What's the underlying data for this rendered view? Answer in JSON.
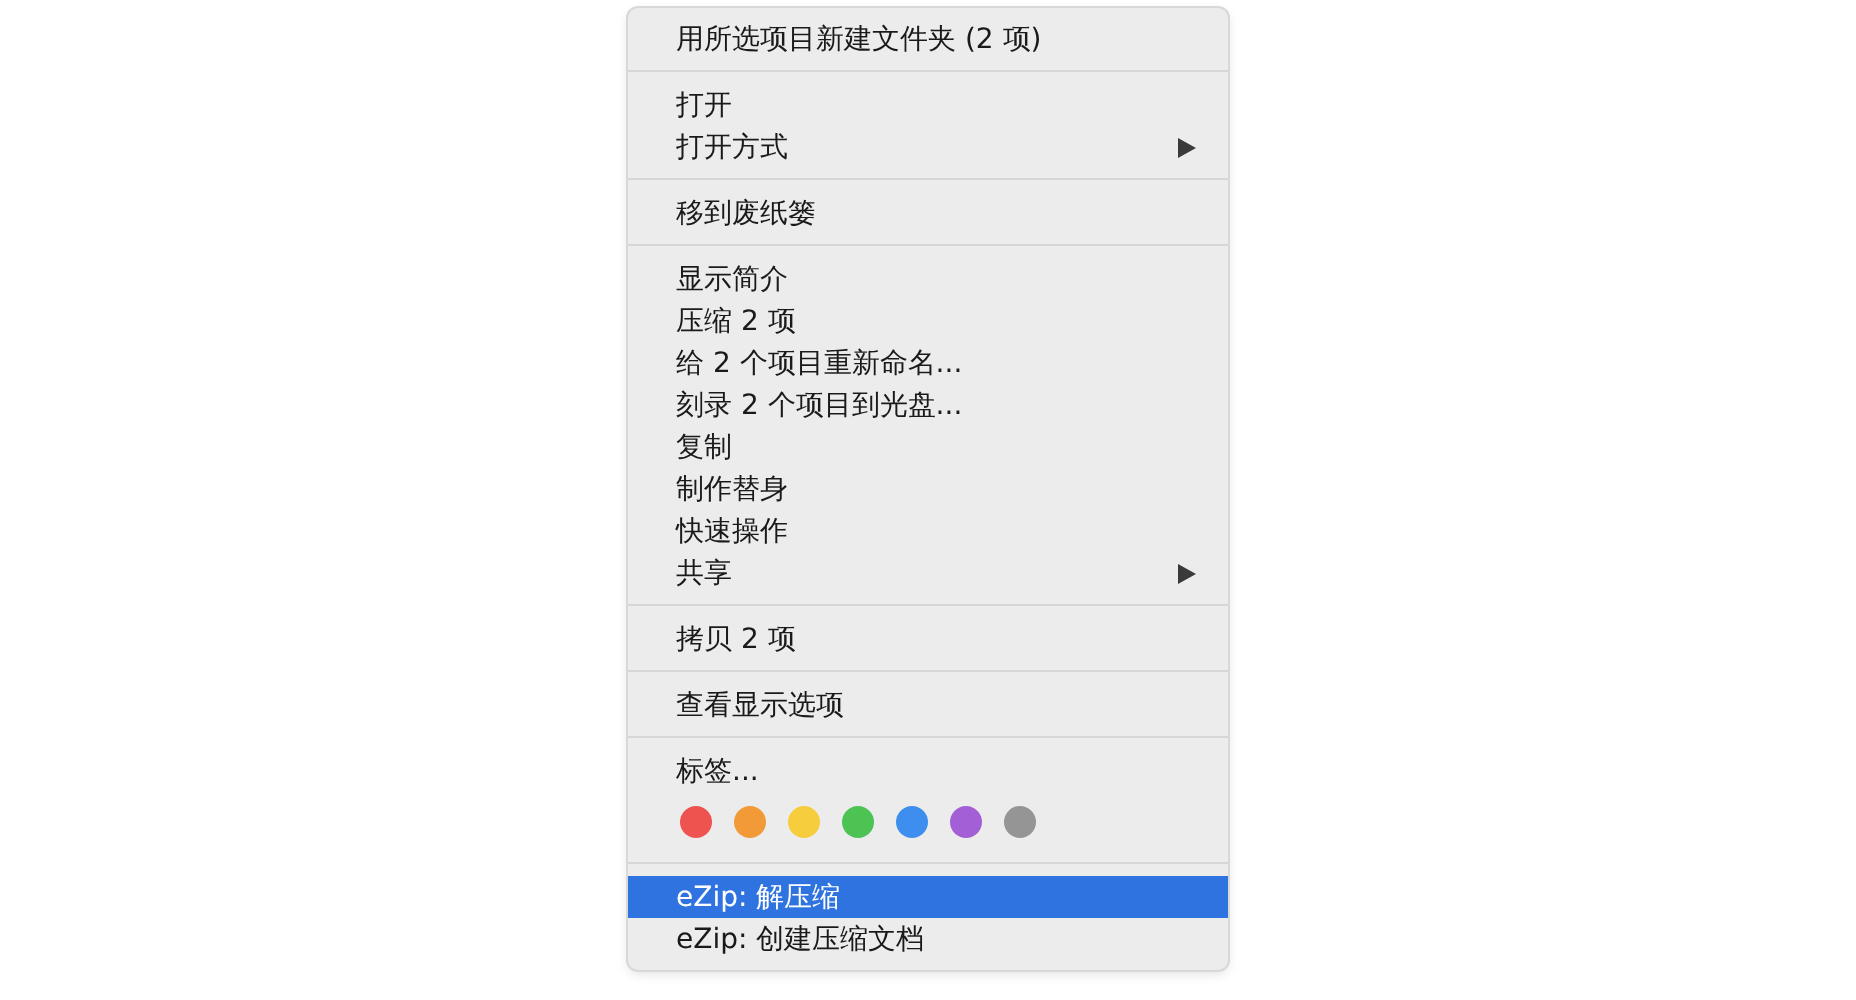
{
  "menu": {
    "sections": [
      {
        "items": [
          {
            "kind": "item",
            "label": "用所选项目新建文件夹 (2 项)",
            "submenu": false,
            "selected": false
          }
        ]
      },
      {
        "items": [
          {
            "kind": "item",
            "label": "打开",
            "submenu": false,
            "selected": false
          },
          {
            "kind": "item",
            "label": "打开方式",
            "submenu": true,
            "selected": false
          }
        ]
      },
      {
        "items": [
          {
            "kind": "item",
            "label": "移到废纸篓",
            "submenu": false,
            "selected": false
          }
        ]
      },
      {
        "items": [
          {
            "kind": "item",
            "label": "显示简介",
            "submenu": false,
            "selected": false
          },
          {
            "kind": "item",
            "label": "压缩 2 项",
            "submenu": false,
            "selected": false
          },
          {
            "kind": "item",
            "label": "给 2 个项目重新命名...",
            "submenu": false,
            "selected": false
          },
          {
            "kind": "item",
            "label": "刻录 2 个项目到光盘...",
            "submenu": false,
            "selected": false
          },
          {
            "kind": "item",
            "label": "复制",
            "submenu": false,
            "selected": false
          },
          {
            "kind": "item",
            "label": "制作替身",
            "submenu": false,
            "selected": false
          },
          {
            "kind": "item",
            "label": "快速操作",
            "submenu": false,
            "selected": false
          },
          {
            "kind": "item",
            "label": "共享",
            "submenu": true,
            "selected": false
          }
        ]
      },
      {
        "items": [
          {
            "kind": "item",
            "label": "拷贝 2 项",
            "submenu": false,
            "selected": false
          }
        ]
      },
      {
        "items": [
          {
            "kind": "item",
            "label": "查看显示选项",
            "submenu": false,
            "selected": false
          }
        ]
      },
      {
        "items": [
          {
            "kind": "item",
            "label": "标签...",
            "submenu": false,
            "selected": false
          },
          {
            "kind": "colors",
            "colors": [
              {
                "color": "#ef5350"
              },
              {
                "color": "#f29a38"
              },
              {
                "color": "#f6cd3c"
              },
              {
                "color": "#4cc352"
              },
              {
                "color": "#3e8ef0"
              },
              {
                "color": "#a35fd6"
              },
              {
                "color": "#959595"
              }
            ]
          }
        ]
      },
      {
        "items": [
          {
            "kind": "item",
            "label": "eZip: 解压缩",
            "submenu": false,
            "selected": true
          },
          {
            "kind": "item",
            "label": "eZip: 创建压缩文档",
            "submenu": false,
            "selected": false
          }
        ]
      }
    ]
  }
}
